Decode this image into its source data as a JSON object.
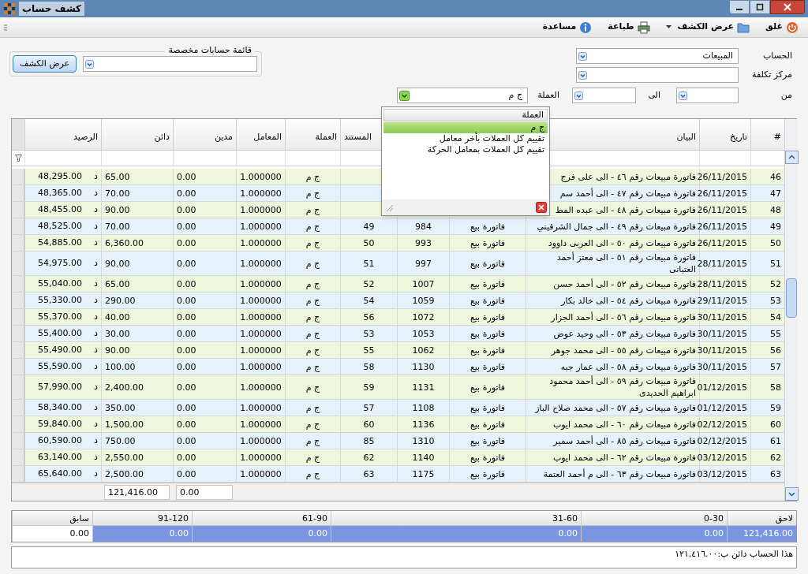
{
  "window": {
    "title": "كشف حساب"
  },
  "toolbar": [
    {
      "label": "غلق",
      "kind": "close",
      "menu": false
    },
    {
      "label": "عرض الكشف",
      "kind": "folder",
      "menu": true
    },
    {
      "label": "طباعة",
      "kind": "print",
      "menu": false
    },
    {
      "label": "مساعدة",
      "kind": "help",
      "menu": false
    }
  ],
  "form": {
    "account": {
      "label": "الحساب",
      "value": "المبيعات"
    },
    "cost_center": {
      "label": "مركز تكلفة"
    },
    "from": {
      "label": "من"
    },
    "to": {
      "label": "الى"
    },
    "currency": {
      "label": "العملة",
      "value": "ج م"
    }
  },
  "custom_list": {
    "legend": "قائمة حسابات مخصصة",
    "button": "عرض الكشف"
  },
  "currency_dropdown": {
    "header": "العملة",
    "items": [
      {
        "label": "ج م",
        "selected": true
      },
      {
        "label": "تقييم كل العملات بأخر معامل",
        "selected": false
      },
      {
        "label": "تقييم كل العملات بمعامل الحركة",
        "selected": false
      }
    ]
  },
  "table": {
    "columns": [
      "#",
      "تاريخ",
      "البيان",
      "",
      "",
      "المستند",
      "العملة",
      "المعامل",
      "مدين",
      "دائن",
      "الرصيد"
    ],
    "rows": [
      {
        "no": "46",
        "date": "26/11/2015",
        "desc": "فاتورة مبيعات رقم ٤٦ - الى على فرج",
        "currency": "ج م",
        "rate": "1.000000",
        "debit": "0.00",
        "credit": "65.00",
        "side": "د",
        "balance": "48,295.00"
      },
      {
        "no": "47",
        "date": "26/11/2015",
        "desc": "فاتورة مبيعات رقم ٤٧ - الى أحمد سم",
        "currency": "ج م",
        "rate": "1.000000",
        "debit": "0.00",
        "credit": "70.00",
        "side": "د",
        "balance": "48,365.00"
      },
      {
        "no": "48",
        "date": "26/11/2015",
        "desc": "فاتورة مبيعات رقم ٤٨ - الى عبده المط",
        "currency": "ج م",
        "rate": "1.000000",
        "debit": "0.00",
        "credit": "90.00",
        "side": "د",
        "balance": "48,455.00"
      },
      {
        "no": "49",
        "date": "26/11/2015",
        "desc": "فاتورة مبيعات رقم ٤٩ - الى جمال الشرقيني",
        "type": "فاتورة بيع",
        "ref": "984",
        "doc": "49",
        "currency": "ج م",
        "rate": "1.000000",
        "debit": "0.00",
        "credit": "70.00",
        "side": "د",
        "balance": "48,525.00"
      },
      {
        "no": "50",
        "date": "26/11/2015",
        "desc": "فاتورة مبيعات رقم ٥٠ - الى العربى داوود",
        "type": "فاتورة بيع",
        "ref": "993",
        "doc": "50",
        "currency": "ج م",
        "rate": "1.000000",
        "debit": "0.00",
        "credit": "6,360.00",
        "side": "د",
        "balance": "54,885.00"
      },
      {
        "no": "51",
        "date": "28/11/2015",
        "desc": "فاتورة مبيعات رقم ٥١ - الى معتز أحمد العتبانى",
        "type": "فاتورة بيع",
        "ref": "997",
        "doc": "51",
        "currency": "ج م",
        "rate": "1.000000",
        "debit": "0.00",
        "credit": "90.00",
        "side": "د",
        "balance": "54,975.00"
      },
      {
        "no": "52",
        "date": "28/11/2015",
        "desc": "فاتورة مبيعات رقم ٥٢ - الى أحمد حسن",
        "type": "فاتورة بيع",
        "ref": "1007",
        "doc": "52",
        "currency": "ج م",
        "rate": "1.000000",
        "debit": "0.00",
        "credit": "65.00",
        "side": "د",
        "balance": "55,040.00"
      },
      {
        "no": "53",
        "date": "29/11/2015",
        "desc": "فاتورة مبيعات رقم ٥٤ - الى خالد بكار",
        "type": "فاتورة بيع",
        "ref": "1059",
        "doc": "54",
        "currency": "ج م",
        "rate": "1.000000",
        "debit": "0.00",
        "credit": "290.00",
        "side": "د",
        "balance": "55,330.00"
      },
      {
        "no": "54",
        "date": "30/11/2015",
        "desc": "فاتورة مبيعات رقم ٥٦ - الى أحمد الجزار",
        "type": "فاتورة بيع",
        "ref": "1072",
        "doc": "56",
        "currency": "ج م",
        "rate": "1.000000",
        "debit": "0.00",
        "credit": "40.00",
        "side": "د",
        "balance": "55,370.00"
      },
      {
        "no": "55",
        "date": "30/11/2015",
        "desc": "فاتورة مبيعات رقم ٥٣ - الى وحيد عوض",
        "type": "فاتورة بيع",
        "ref": "1053",
        "doc": "53",
        "currency": "ج م",
        "rate": "1.000000",
        "debit": "0.00",
        "credit": "30.00",
        "side": "د",
        "balance": "55,400.00"
      },
      {
        "no": "56",
        "date": "30/11/2015",
        "desc": "فاتورة مبيعات رقم ٥٥ - الى محمد جوهر",
        "type": "فاتورة بيع",
        "ref": "1062",
        "doc": "55",
        "currency": "ج م",
        "rate": "1.000000",
        "debit": "0.00",
        "credit": "90.00",
        "side": "د",
        "balance": "55,490.00"
      },
      {
        "no": "57",
        "date": "30/11/2015",
        "desc": "فاتورة مبيعات رقم ٥٨ - الى عمار جبه",
        "type": "فاتورة بيع",
        "ref": "1130",
        "doc": "58",
        "currency": "ج م",
        "rate": "1.000000",
        "debit": "0.00",
        "credit": "100.00",
        "side": "د",
        "balance": "55,590.00"
      },
      {
        "no": "58",
        "date": "01/12/2015",
        "desc": "فاتورة مبيعات رقم ٥٩ - الى أحمد محمود ابراهيم الحديدى",
        "type": "فاتورة بيع",
        "ref": "1131",
        "doc": "59",
        "currency": "ج م",
        "rate": "1.000000",
        "debit": "0.00",
        "credit": "2,400.00",
        "side": "د",
        "balance": "57,990.00"
      },
      {
        "no": "59",
        "date": "01/12/2015",
        "desc": "فاتورة مبيعات رقم ٥٧ - الى محمد صلاح الباز",
        "type": "فاتورة بيع",
        "ref": "1108",
        "doc": "57",
        "currency": "ج م",
        "rate": "1.000000",
        "debit": "0.00",
        "credit": "350.00",
        "side": "د",
        "balance": "58,340.00"
      },
      {
        "no": "60",
        "date": "02/12/2015",
        "desc": "فاتورة مبيعات رقم ٦٠ - الى محمد ايوب",
        "type": "فاتورة بيع",
        "ref": "1136",
        "doc": "60",
        "currency": "ج م",
        "rate": "1.000000",
        "debit": "0.00",
        "credit": "1,500.00",
        "side": "د",
        "balance": "59,840.00"
      },
      {
        "no": "61",
        "date": "02/12/2015",
        "desc": "فاتورة مبيعات رقم ٨٥ - الى أحمد سمير",
        "type": "فاتورة بيع",
        "ref": "1310",
        "doc": "85",
        "currency": "ج م",
        "rate": "1.000000",
        "debit": "0.00",
        "credit": "750.00",
        "side": "د",
        "balance": "60,590.00"
      },
      {
        "no": "62",
        "date": "03/12/2015",
        "desc": "فاتورة مبيعات رقم ٦٢ - الى محمد ايوب",
        "type": "فاتورة بيع",
        "ref": "1140",
        "doc": "62",
        "currency": "ج م",
        "rate": "1.000000",
        "debit": "0.00",
        "credit": "2,550.00",
        "side": "د",
        "balance": "63,140.00"
      },
      {
        "no": "63",
        "date": "03/12/2015",
        "desc": "فاتورة مبيعات رقم ٦٣ - الى م أحمد العتمة",
        "type": "فاتورة بيع",
        "ref": "1175",
        "doc": "63",
        "currency": "ج م",
        "rate": "1.000000",
        "debit": "0.00",
        "credit": "2,500.00",
        "side": "د",
        "balance": "65,640.00"
      }
    ],
    "totals": {
      "debit": "0.00",
      "credit": "121,416.00"
    }
  },
  "aging": [
    {
      "label": "لاحق",
      "value": "121,416.00",
      "selected": true
    },
    {
      "label": "0-30",
      "value": "0.00",
      "selected": true
    },
    {
      "label": "31-60",
      "value": "0.00",
      "selected": true
    },
    {
      "label": "61-90",
      "value": "0.00",
      "selected": true
    },
    {
      "label": "91-120",
      "value": "0.00",
      "selected": true
    },
    {
      "label": "سابق",
      "value": "0.00",
      "selected": false
    }
  ],
  "note": "هذا الحساب دائن ب:١٢١,٤١٦.٠٠"
}
